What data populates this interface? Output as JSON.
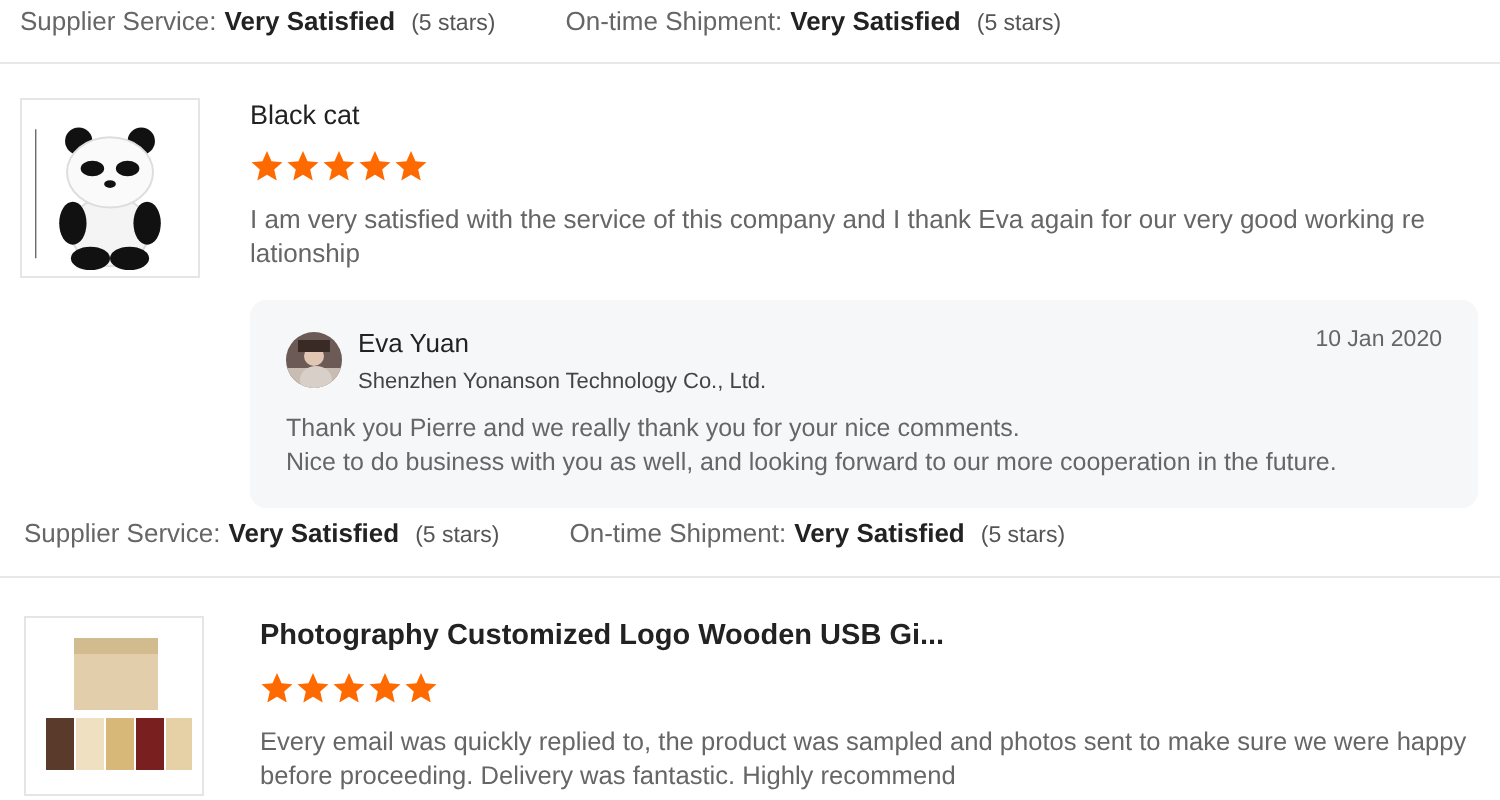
{
  "top_ratings": {
    "supplier_label": "Supplier Service:",
    "supplier_value": "Very Satisfied",
    "supplier_stars": "(5 stars)",
    "shipment_label": "On-time Shipment:",
    "shipment_value": "Very Satisfied",
    "shipment_stars": "(5 stars)"
  },
  "reviews": [
    {
      "title": "Black cat",
      "stars": 5,
      "text": "I am very satisfied with the service of this company and I thank Eva again for our very good working relationship",
      "reply": {
        "name": "Eva Yuan",
        "company": "Shenzhen Yonanson Technology Co., Ltd.",
        "date": "10 Jan 2020",
        "lines": [
          "Thank you Pierre and we really thank you for your nice comments.",
          "Nice to do business with you as well, and looking forward to our more cooperation in the future."
        ]
      },
      "ratings": {
        "supplier_label": "Supplier Service:",
        "supplier_value": "Very Satisfied",
        "supplier_stars": "(5 stars)",
        "shipment_label": "On-time Shipment:",
        "shipment_value": "Very Satisfied",
        "shipment_stars": "(5 stars)"
      }
    },
    {
      "title": "Photography Customized Logo Wooden USB Gi...",
      "stars": 5,
      "text": "Every email was quickly replied to, the product was sampled and photos sent to make sure we were happy before proceeding. Delivery was fantastic. Highly recommend"
    }
  ]
}
